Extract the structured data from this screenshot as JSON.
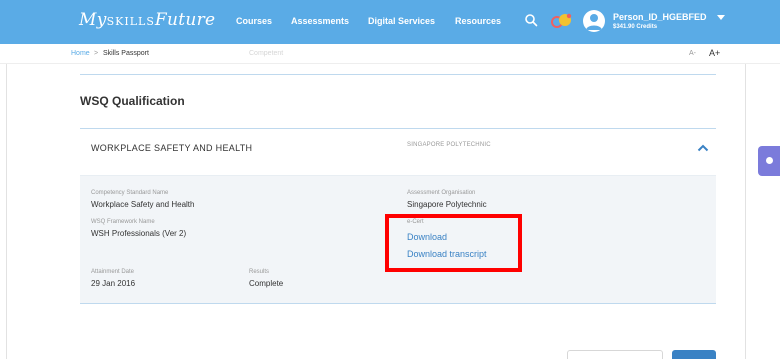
{
  "header": {
    "logo_prefix": "My",
    "logo_mid": "SKILLS",
    "logo_suffix": "Future",
    "nav": [
      "Courses",
      "Assessments",
      "Digital Services",
      "Resources"
    ],
    "user_name": "Person_ID_HGEBFED",
    "user_credits": "$341.90 Credits",
    "icons": {
      "search": "search-icon",
      "notification": "notification-badge-icon",
      "avatar": "user-avatar-icon",
      "caret": "chevron-down-icon"
    }
  },
  "breadcrumb": {
    "home": "Home",
    "separator": ">",
    "current": "Skills Passport"
  },
  "faded_header_text": "Competent",
  "font_controls": {
    "decrease": "A-",
    "increase": "A+"
  },
  "section_title": "WSQ Qualification",
  "qualification": {
    "title": "WORKPLACE SAFETY AND HEALTH",
    "provider": "SINGAPORE POLYTECHNIC",
    "competency_label": "Competency Standard Name",
    "competency_value": "Workplace Safety and Health",
    "framework_label": "WSQ Framework Name",
    "framework_value": "WSH Professionals (Ver 2)",
    "attainment_label": "Attainment Date",
    "attainment_value": "29 Jan 2016",
    "results_label": "Results",
    "results_value": "Complete",
    "org_label": "Assessment Organisation",
    "org_value": "Singapore Polytechnic",
    "ecert_label": "e-Cert",
    "download_link": "Download",
    "download_transcript_link": "Download transcript"
  },
  "colors": {
    "header_bg": "#5aabe6",
    "link": "#3a82c4",
    "highlight": "#ff0000",
    "side_tab": "#7b7bdb"
  }
}
